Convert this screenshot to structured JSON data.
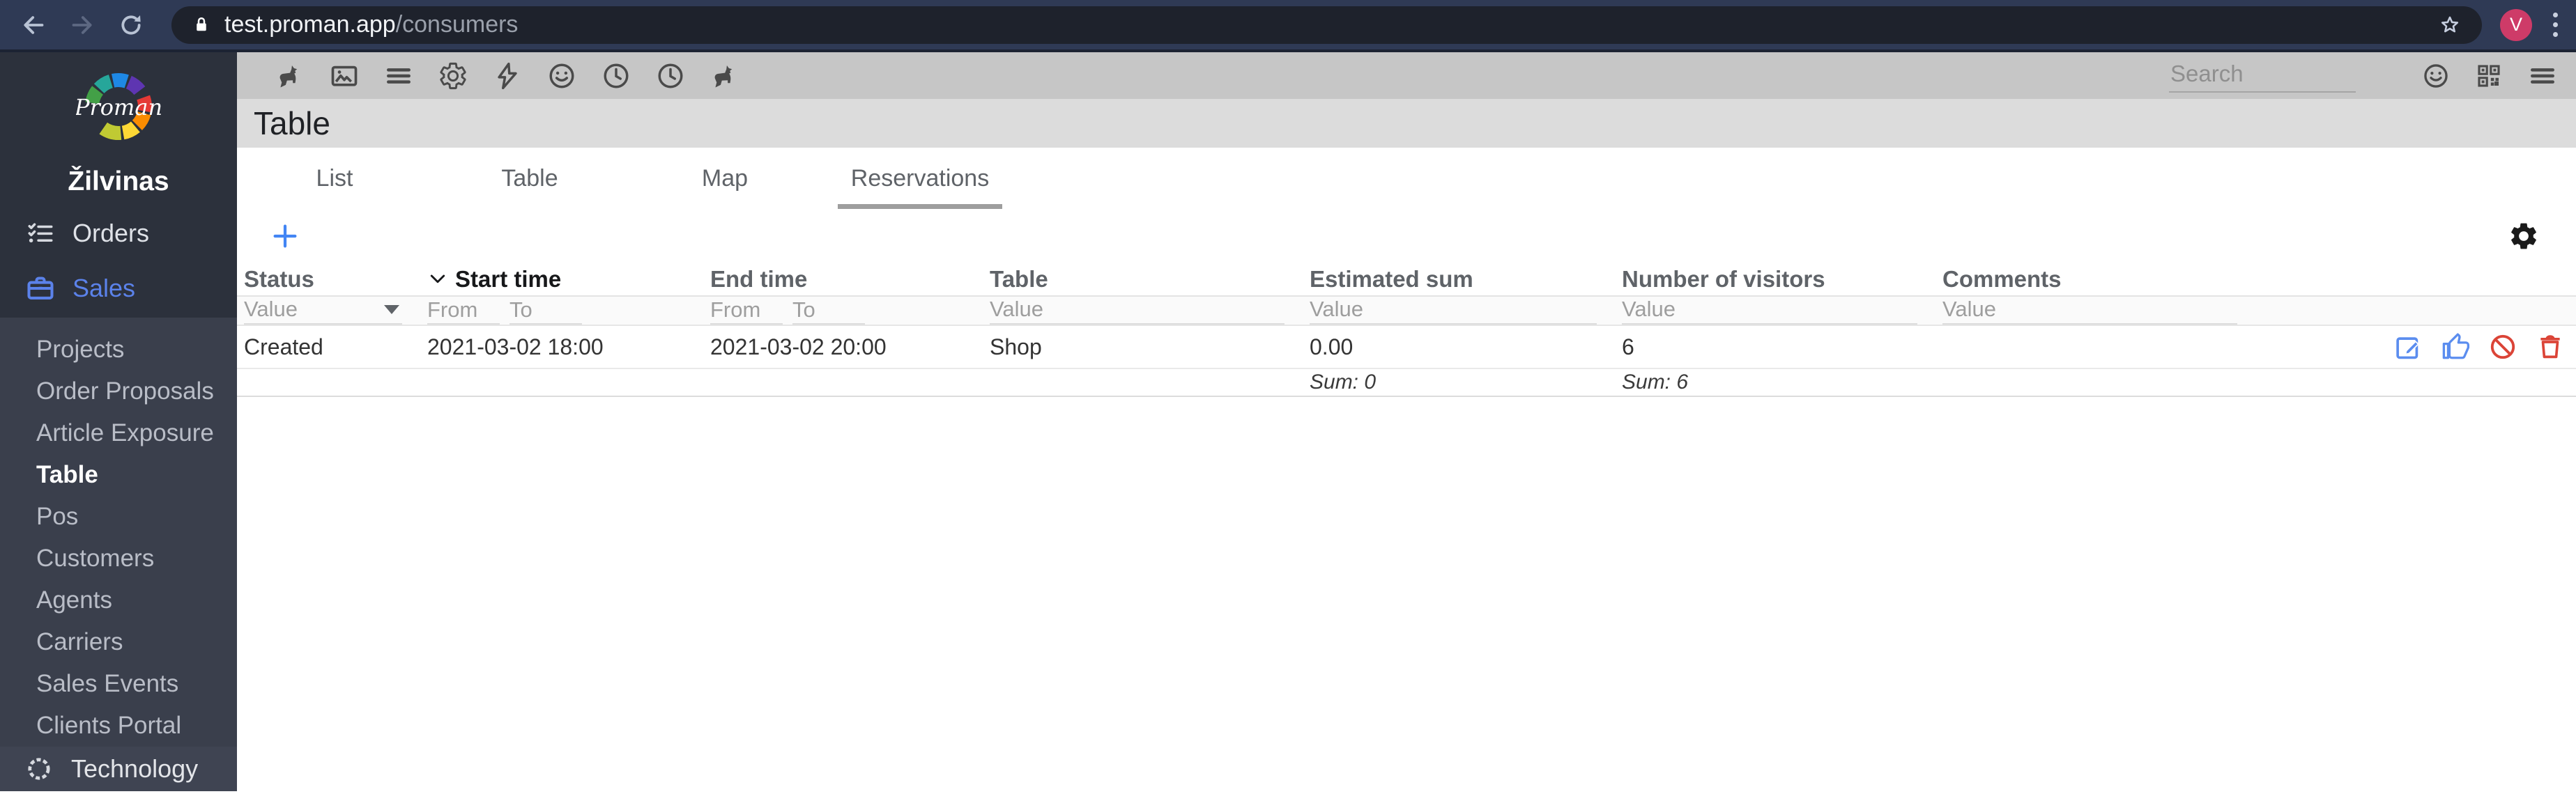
{
  "browser": {
    "url_host": "test.proman.app",
    "url_path": "/consumers",
    "avatar_letter": "V"
  },
  "app_toolbar": {
    "left_icons": [
      "unicorn",
      "image",
      "menu",
      "gear",
      "bolt",
      "smiley",
      "clock",
      "clock",
      "unicorn"
    ],
    "search_placeholder": "Search",
    "right_icons": [
      "smiley",
      "qr-code",
      "menu"
    ]
  },
  "sidebar": {
    "logo_text": "Proman",
    "user_name": "Žilvinas",
    "main_items": [
      {
        "label": "Orders",
        "icon": "checklist"
      },
      {
        "label": "Sales",
        "icon": "briefcase",
        "active": true
      }
    ],
    "sub_items": [
      "Projects",
      "Order Proposals",
      "Article Exposure",
      "Table",
      "Pos",
      "Customers",
      "Agents",
      "Carriers",
      "Sales Events",
      "Clients Portal"
    ],
    "active_sub_item": "Table",
    "bottom_item": "Technology"
  },
  "page": {
    "title": "Table",
    "tabs": [
      "List",
      "Table",
      "Map",
      "Reservations"
    ],
    "active_tab": "Reservations"
  },
  "reservations_table": {
    "columns": [
      "Status",
      "Start time",
      "End time",
      "Table",
      "Estimated sum",
      "Number of visitors",
      "Comments"
    ],
    "sorted_column": "Start time",
    "sort_direction": "desc",
    "filters": {
      "status": "Value",
      "start_from": "From",
      "start_to": "To",
      "end_from": "From",
      "end_to": "To",
      "table": "Value",
      "estimated_sum": "Value",
      "visitors": "Value",
      "comments": "Value"
    },
    "rows": [
      {
        "status": "Created",
        "start_time": "2021-03-02 18:00",
        "end_time": "2021-03-02 20:00",
        "table": "Shop",
        "estimated_sum": "0.00",
        "visitors": "6",
        "comments": "",
        "actions": [
          "edit",
          "approve",
          "block",
          "delete"
        ]
      }
    ],
    "summary": {
      "estimated_sum": "Sum: 0",
      "visitors": "Sum: 6"
    }
  },
  "colors": {
    "accent_blue": "#4285f4",
    "sidebar_active_blue": "#5b82ea",
    "danger_red": "#db4437",
    "chrome_bg": "#2f3a55",
    "toolbar_bg": "#c6c6c6",
    "title_bg": "#dcdcdc",
    "sidebar_bg": "#2c313c",
    "sidebar_sub_bg": "#3a3f4c",
    "avatar_pink": "#ce3b68"
  }
}
